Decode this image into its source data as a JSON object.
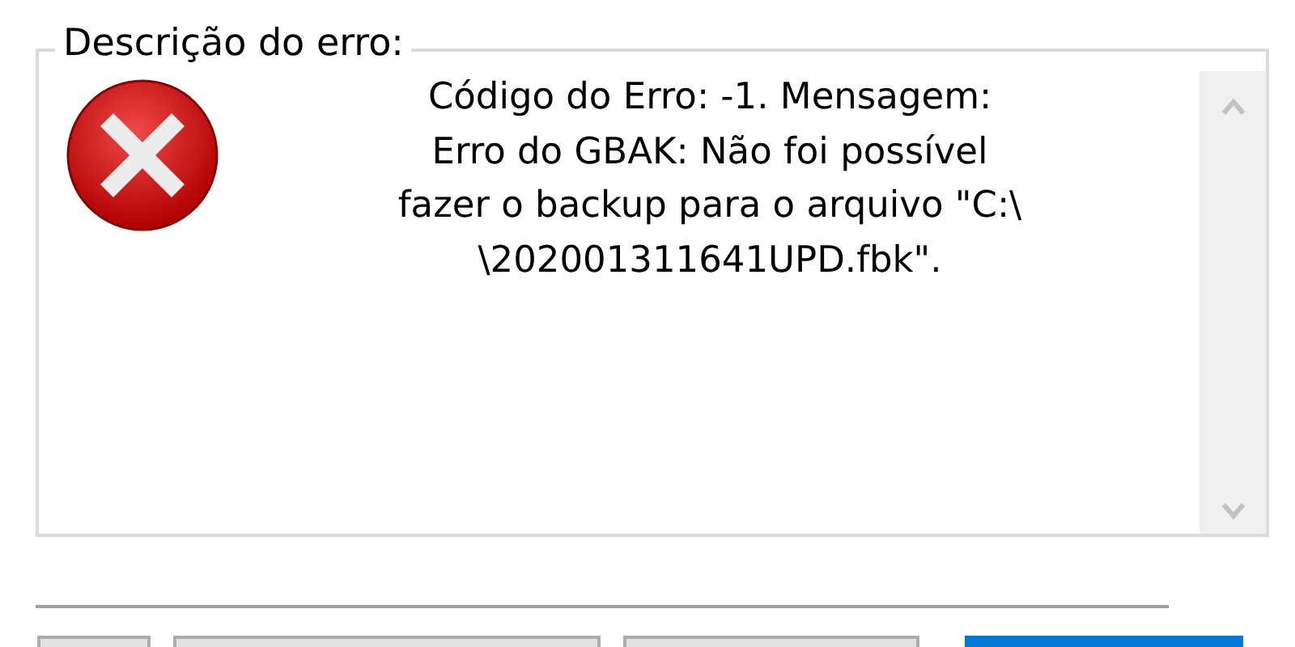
{
  "group": {
    "title": "Descrição do erro:"
  },
  "message": {
    "lines": [
      "Código do Erro: -1. Mensagem:",
      "Erro do GBAK: Não foi possível",
      "fazer o backup para o arquivo \"C:\\",
      "\\202001311641UPD.fbk\"."
    ]
  },
  "buttons": [
    {
      "default": false
    },
    {
      "default": false
    },
    {
      "default": false
    },
    {
      "default": true
    }
  ]
}
